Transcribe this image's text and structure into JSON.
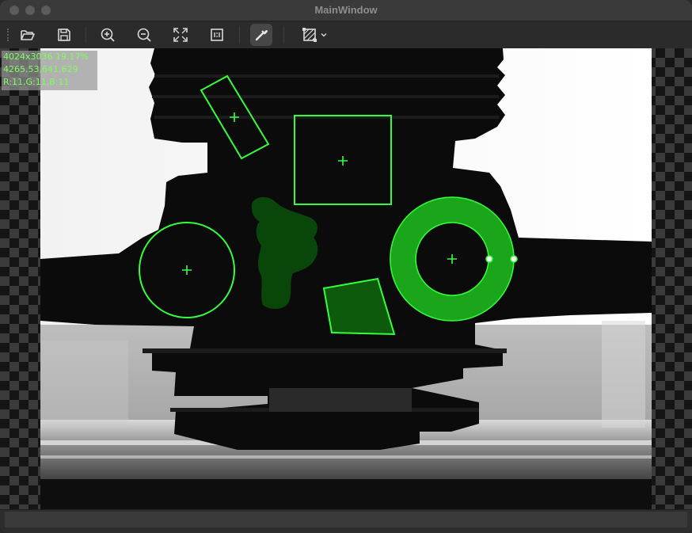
{
  "window": {
    "title": "MainWindow"
  },
  "toolbar": {
    "buttons": [
      {
        "name": "open-folder-button",
        "icon": "folder-open-icon"
      },
      {
        "name": "save-button",
        "icon": "save-icon"
      },
      {
        "name": "zoom-in-button",
        "icon": "zoom-in-icon"
      },
      {
        "name": "zoom-out-button",
        "icon": "zoom-out-icon"
      },
      {
        "name": "fit-to-window-button",
        "icon": "fit-window-icon"
      },
      {
        "name": "actual-size-button",
        "icon": "actual-size-icon"
      },
      {
        "name": "color-picker-button",
        "icon": "eyedropper-icon",
        "active": true
      },
      {
        "name": "roi-shape-dropdown-button",
        "icon": "roi-shape-icon"
      }
    ]
  },
  "pixel_info": {
    "line1": "4024x3036 19.17%",
    "line2": "4265.53,641.629",
    "line3": "R:11,G:11,B:11"
  },
  "colors": {
    "roi": "#34ff3c",
    "roi_fill": "#1aa51a",
    "info_text": "#7dff5b"
  }
}
